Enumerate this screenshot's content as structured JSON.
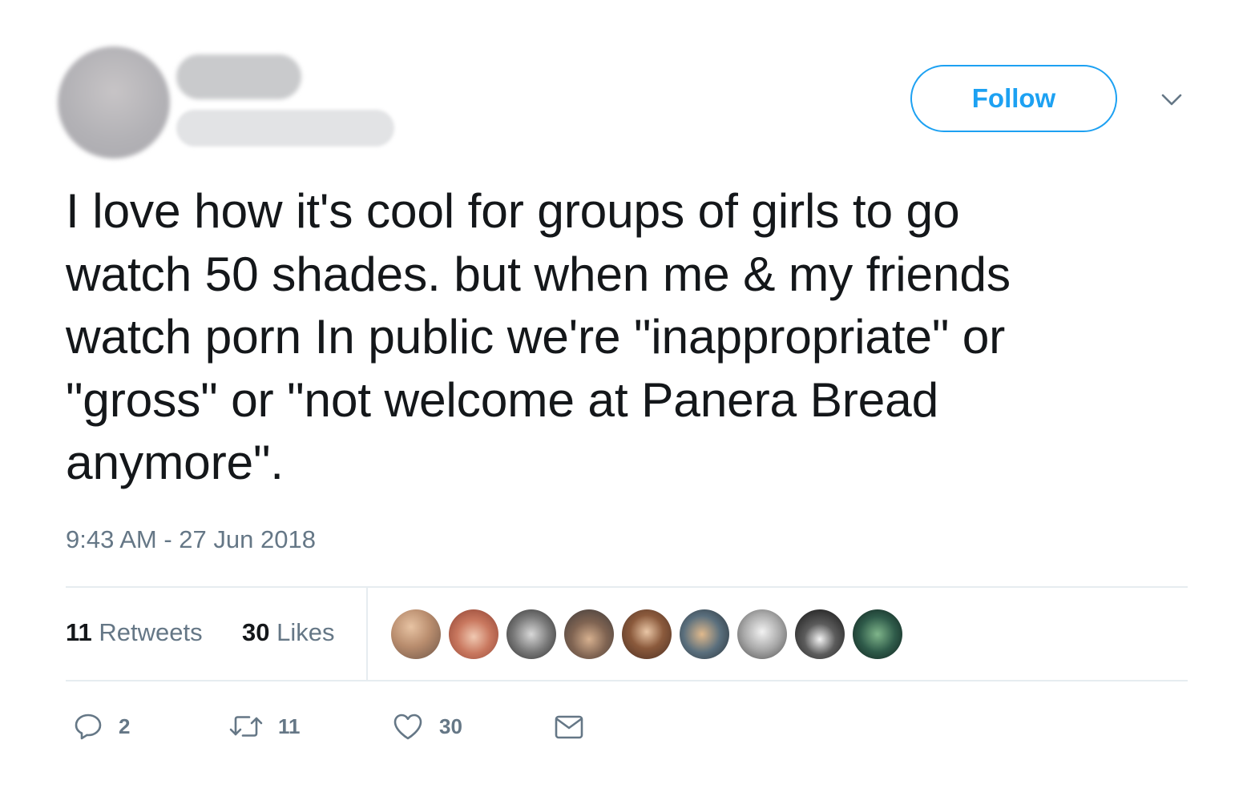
{
  "header": {
    "follow_label": "Follow"
  },
  "tweet": {
    "text": "I love how it's cool for groups of girls to go\nwatch 50 shades. but when me & my friends\nwatch porn In public we're \"inappropriate\" or\n\"gross\" or \"not welcome at Panera Bread\nanymore\".",
    "timestamp": "9:43 AM - 27 Jun 2018"
  },
  "stats": {
    "retweets_count": "11",
    "retweets_label": "Retweets",
    "likes_count": "30",
    "likes_label": "Likes"
  },
  "actions": {
    "reply_count": "2",
    "retweet_count": "11",
    "like_count": "30"
  },
  "colors": {
    "accent": "#1da1f2",
    "secondary_text": "#657786",
    "divider": "#e6ecf0"
  },
  "icons": [
    "chevron-down-icon",
    "reply-icon",
    "retweet-icon",
    "like-icon",
    "message-icon"
  ]
}
